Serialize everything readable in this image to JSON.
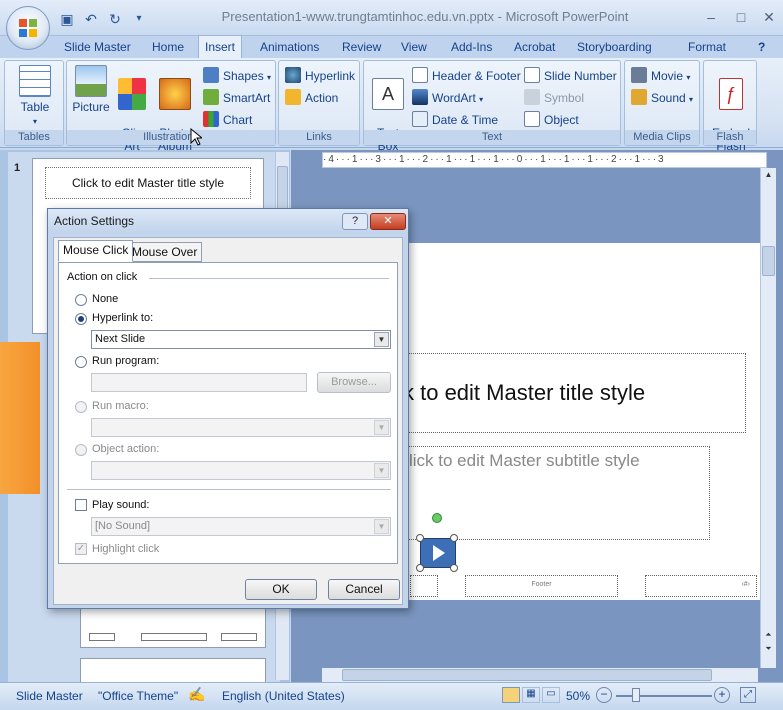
{
  "window": {
    "title": "Presentation1-www.trungtamtinhoc.edu.vn.pptx - Microsoft PowerPoint",
    "controls": [
      "–",
      "□",
      "✕"
    ]
  },
  "qat": {
    "icons": [
      "save-icon",
      "undo-icon",
      "redo-icon",
      "customize-icon"
    ]
  },
  "tabs": [
    "Slide Master",
    "Home",
    "Insert",
    "Animations",
    "Review",
    "View",
    "Add-Ins",
    "Acrobat",
    "Storyboarding",
    "Format"
  ],
  "active_tab": "Insert",
  "ribbon": {
    "tables": {
      "label": "Tables",
      "table": "Table"
    },
    "illustrations": {
      "label": "Illustrations",
      "picture": "Picture",
      "clip_art": "Clip\nArt",
      "photo_album": "Photo\nAlbum",
      "shapes": "Shapes",
      "smartart": "SmartArt",
      "chart": "Chart"
    },
    "links": {
      "label": "Links",
      "hyperlink": "Hyperlink",
      "action": "Action"
    },
    "text": {
      "label": "Text",
      "text_box": "Text\nBox",
      "header_footer": "Header & Footer",
      "wordart": "WordArt",
      "date_time": "Date & Time",
      "slide_number": "Slide Number",
      "symbol": "Symbol",
      "object": "Object"
    },
    "media": {
      "label": "Media Clips",
      "movie": "Movie",
      "sound": "Sound"
    },
    "flash": {
      "label": "Flash",
      "embed_flash": "Embed\nFlash"
    }
  },
  "slides_pane": {
    "slide_number": "1",
    "thumb_title": "Click to edit Master title style"
  },
  "ruler": "·4···1···3···1···2···1···1···1···0···1···1···1···2···1···3",
  "slide": {
    "title": "k to edit Master title style",
    "subtitle": "lick to edit Master subtitle style",
    "footer": "Footer",
    "page_num": "‹#›"
  },
  "dialog": {
    "title": "Action Settings",
    "help": "?",
    "close": "✕",
    "tabs": [
      "Mouse Click",
      "Mouse Over"
    ],
    "section": "Action on click",
    "none": "None",
    "hyperlink_to": "Hyperlink to:",
    "hyperlink_value": "Next Slide",
    "run_program": "Run program:",
    "browse": "Browse...",
    "run_macro": "Run macro:",
    "object_action": "Object action:",
    "play_sound": "Play sound:",
    "sound_value": "[No Sound]",
    "highlight_click": "Highlight click",
    "ok": "OK",
    "cancel": "Cancel",
    "selected_option": "Hyperlink to:"
  },
  "status": {
    "slide_master": "Slide Master",
    "theme": "\"Office Theme\"",
    "language": "English (United States)",
    "zoom": "50%"
  },
  "colors": {
    "accent": "#15428b",
    "ribbon_bg": "#dce7f5",
    "slide_bg": "#7a96c0"
  }
}
